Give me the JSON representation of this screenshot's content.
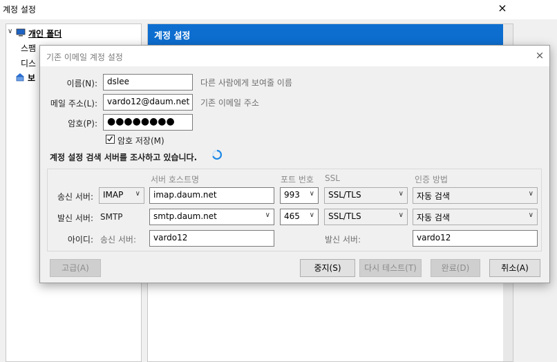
{
  "background": {
    "window_title": "계정 설정",
    "close_icon": "×",
    "header": "계정 설정",
    "tree": {
      "local_folders": "개인 폴더",
      "spam": "스팸 ",
      "disk": "디스",
      "send": "보"
    }
  },
  "dialog": {
    "title": "기존 이메일 계정 설정",
    "close_icon": "×",
    "name": {
      "label": "이름(N):",
      "value": "dslee",
      "hint": "다른 사람에게 보여줄 이름"
    },
    "email": {
      "label": "메일 주소(L):",
      "value": "vardo12@daum.net",
      "hint": "기존 이메일 주소"
    },
    "password": {
      "label": "암호(P):",
      "value": "●●●●●●●●"
    },
    "remember": {
      "label": "암호 저장(M)",
      "checked": true
    },
    "status": "계정 설정 검색 서버를 조사하고 있습니다.",
    "columns": {
      "server_hostname": "서버 호스트명",
      "port": "포트 번호",
      "ssl": "SSL",
      "auth": "인증 방법"
    },
    "incoming": {
      "label": "송신 서버:",
      "protocol": "IMAP",
      "host": "imap.daum.net",
      "port": "993",
      "ssl": "SSL/TLS",
      "auth": "자동 검색"
    },
    "outgoing": {
      "label": "발신 서버:",
      "protocol": "SMTP",
      "host": "smtp.daum.net",
      "port": "465",
      "ssl": "SSL/TLS",
      "auth": "자동 검색"
    },
    "username": {
      "label": "아이디:",
      "incoming_label": "송신 서버:",
      "incoming_value": "vardo12",
      "outgoing_label": "발신 서버:",
      "outgoing_value": "vardo12"
    },
    "buttons": {
      "advanced": "고급(A)",
      "stop": "중지(S)",
      "retest": "다시 테스트(T)",
      "done": "완료(D)",
      "cancel": "취소(A)"
    }
  },
  "colors": {
    "accent": "#0d6ed0",
    "spinner": "#1e88e5"
  }
}
